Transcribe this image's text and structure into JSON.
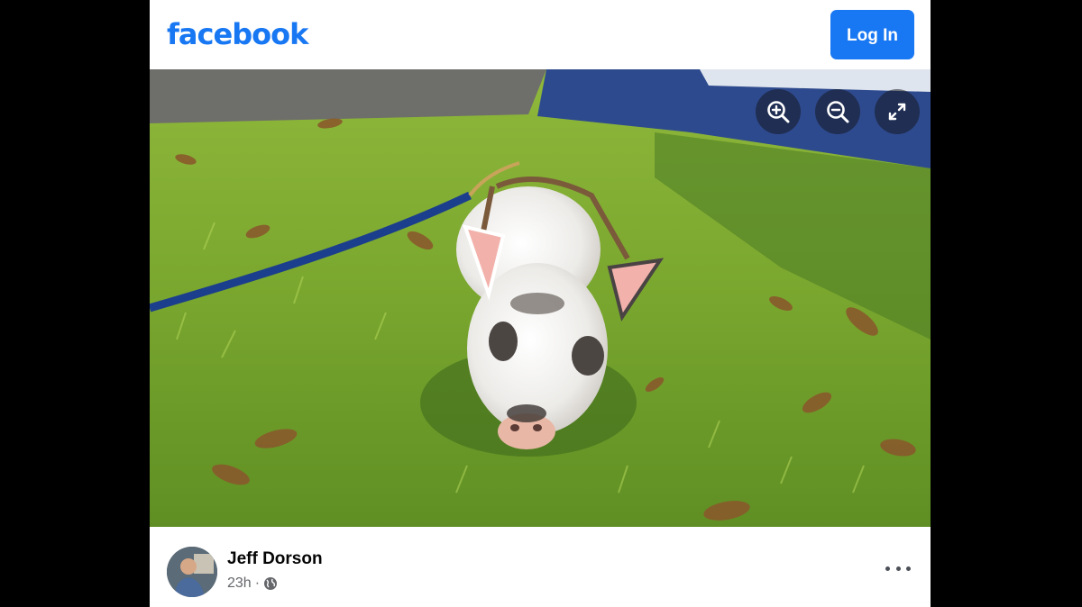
{
  "header": {
    "logo_text": "facebook",
    "login_label": "Log In"
  },
  "photo": {
    "controls": [
      {
        "name": "zoom-in-icon"
      },
      {
        "name": "zoom-out-icon"
      },
      {
        "name": "fullscreen-icon"
      }
    ]
  },
  "post": {
    "author": "Jeff Dorson",
    "time": "23h",
    "separator": "·",
    "audience_icon": "globe-icon",
    "more_icon": "more-options-icon"
  },
  "colors": {
    "brand": "#1877f2",
    "text_primary": "#050505",
    "text_secondary": "#65676b"
  }
}
